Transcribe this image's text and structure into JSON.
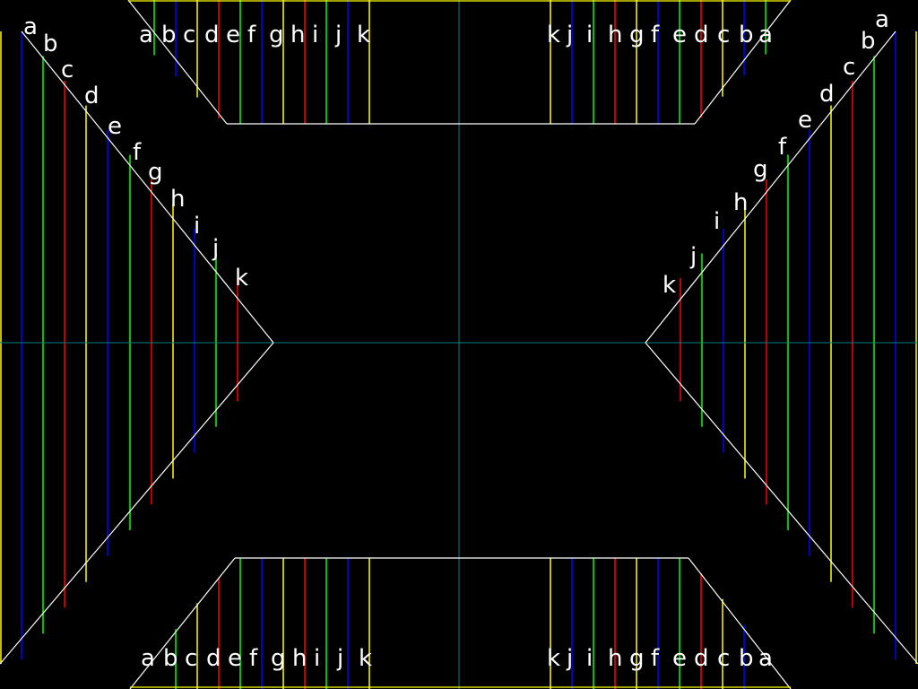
{
  "colors": {
    "background": "#000000",
    "outline": "#ffffff",
    "center_axes": "#008080",
    "line_palette": {
      "yellow": "#ffff00",
      "blue": "#0000ff",
      "green": "#00ff00",
      "red": "#ff0000"
    },
    "label_text": "#ffffff"
  },
  "labels": {
    "letters": [
      "a",
      "b",
      "c",
      "d",
      "e",
      "f",
      "g",
      "h",
      "i",
      "j",
      "k"
    ]
  },
  "line_colors_by_index": [
    "blue",
    "green",
    "red",
    "yellow",
    "blue",
    "green",
    "red",
    "yellow",
    "blue",
    "green",
    "red"
  ]
}
